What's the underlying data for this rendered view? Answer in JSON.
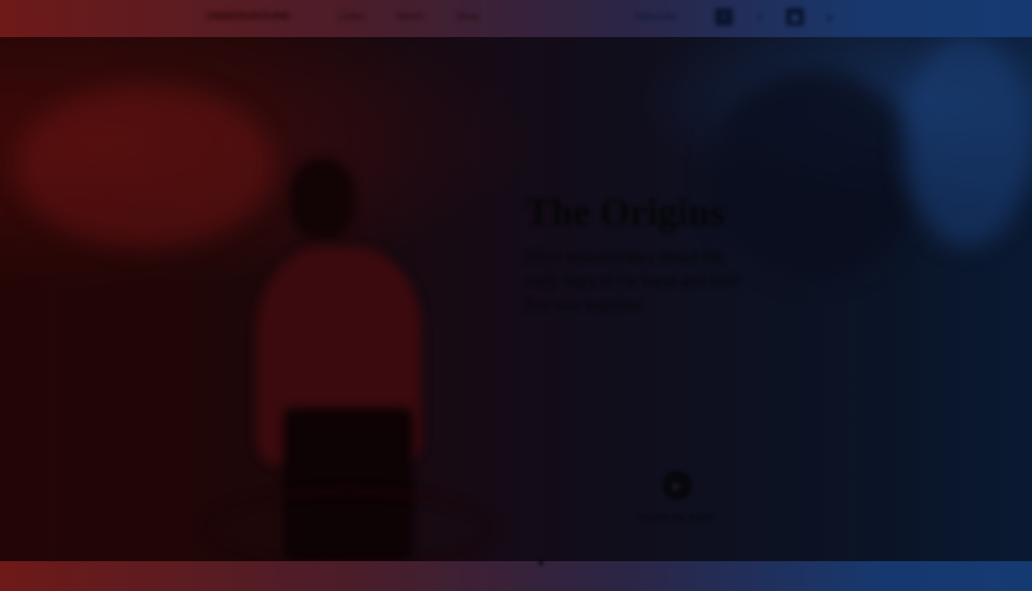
{
  "nav": {
    "brand": "UNDERGROUND",
    "links": [
      "Listen",
      "Watch",
      "Shop"
    ],
    "cta": "Subscribe",
    "social": [
      {
        "icon": "facebook-icon",
        "glyph": "f"
      },
      {
        "icon": "twitter-icon",
        "glyph": "t"
      },
      {
        "icon": "instagram-icon",
        "glyph": "◼"
      },
      {
        "icon": "youtube-icon",
        "glyph": "▸"
      }
    ]
  },
  "hero": {
    "title": "The Origins",
    "body": "Short documentary about the early days of the band and their first tour together.",
    "play_label": "Watch the trailer",
    "play_icon": "play-icon"
  },
  "colors": {
    "left_tint": "#6e1a18",
    "right_tint": "#153a72"
  }
}
